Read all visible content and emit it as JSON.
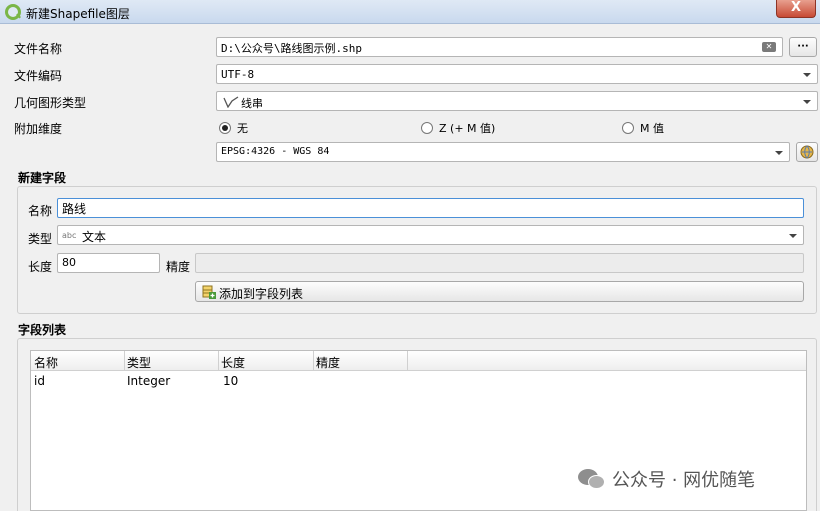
{
  "window": {
    "title": "新建Shapefile图层",
    "close_glyph": "X"
  },
  "form": {
    "file_name_label": "文件名称",
    "file_name_value": "D:\\公众号\\路线图示例.shp",
    "browse_label": "···",
    "encoding_label": "文件编码",
    "encoding_value": "UTF-8",
    "geometry_label": "几何图形类型",
    "geometry_icon": "line-geometry-icon",
    "geometry_value": "线串",
    "dimension_label": "附加维度",
    "dimension_options": [
      "无",
      "Z (+ M 值)",
      "M 值"
    ],
    "dimension_selected": 0,
    "crs_value": "EPSG:4326 - WGS 84"
  },
  "new_field": {
    "section_title": "新建字段",
    "name_label": "名称",
    "name_value": "路线",
    "type_label": "类型",
    "type_prefix": "abc",
    "type_value": "文本",
    "length_label": "长度",
    "length_value": "80",
    "precision_label": "精度",
    "precision_value": "",
    "add_button_label": "添加到字段列表"
  },
  "field_list": {
    "section_title": "字段列表",
    "columns": [
      "名称",
      "类型",
      "长度",
      "精度"
    ],
    "rows": [
      [
        "id",
        "Integer",
        "10",
        ""
      ]
    ]
  },
  "watermark": {
    "text": "公众号 · 网优随笔"
  }
}
